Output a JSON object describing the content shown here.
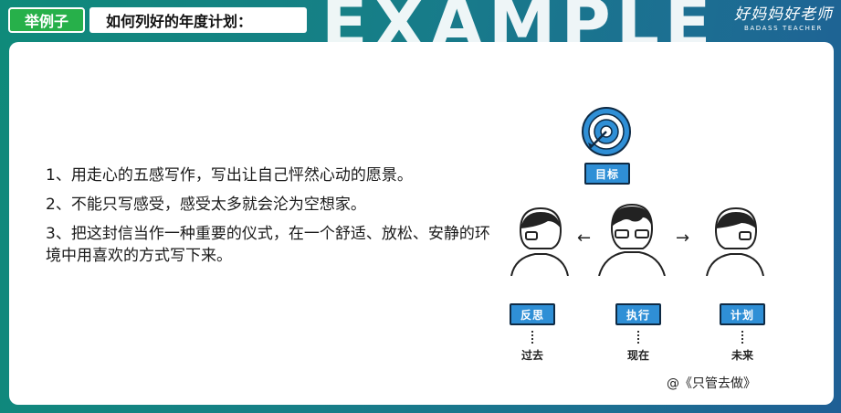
{
  "header": {
    "tag": "举例子",
    "title": "如何列好的年度计划：",
    "watermark": "EXAMPLE",
    "brand_cn": "好妈妈好老师",
    "brand_en": "BADASS TEACHER"
  },
  "points": [
    "1、用走心的五感写作，写出让自己怦然心动的愿景。",
    "2、不能只写感受，感受太多就会沦为空想家。",
    "3、把这封信当作一种重要的仪式，在一个舒适、放松、安静的环境中用喜欢的方式写下来。"
  ],
  "illustration": {
    "goal_label": "目标",
    "left_label": "反思",
    "middle_label": "执行",
    "right_label": "计划",
    "left_time": "过去",
    "middle_time": "现在",
    "right_time": "未来",
    "arrow_left": "←",
    "arrow_right": "→",
    "icons": [
      "target-icon",
      "person-icon"
    ]
  },
  "credit": "@《只管去做》",
  "colors": {
    "background_start": "#0f8a7a",
    "background_end": "#1f5f95",
    "tag_green": "#27b04a",
    "label_blue": "#2f8fd6"
  }
}
